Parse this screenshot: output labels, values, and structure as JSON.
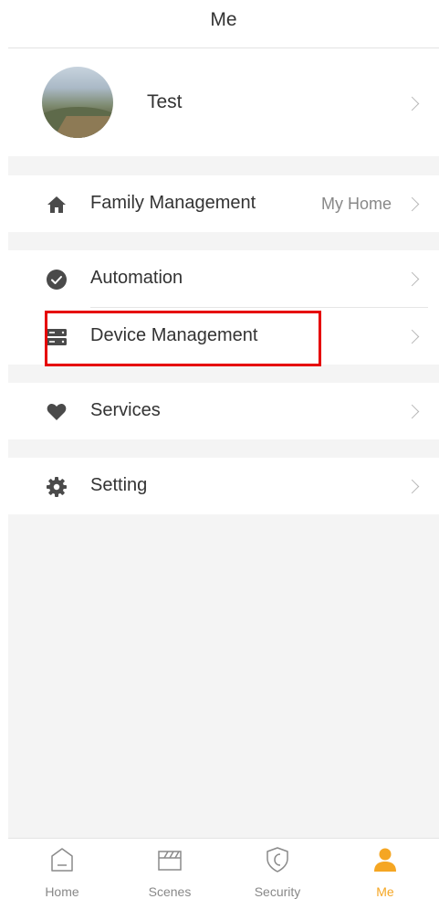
{
  "header": {
    "title": "Me"
  },
  "profile": {
    "name": "Test"
  },
  "menu": {
    "family": {
      "label": "Family Management",
      "value": "My Home"
    },
    "automation": {
      "label": "Automation"
    },
    "device": {
      "label": "Device Management"
    },
    "services": {
      "label": "Services"
    },
    "setting": {
      "label": "Setting"
    }
  },
  "icons": {
    "family": "home-icon",
    "automation": "check-circle-icon",
    "device": "server-icon",
    "services": "heart-icon",
    "setting": "gear-icon"
  },
  "tabs": [
    {
      "label": "Home",
      "icon": "home-outline-icon",
      "active": false
    },
    {
      "label": "Scenes",
      "icon": "clapperboard-icon",
      "active": false
    },
    {
      "label": "Security",
      "icon": "shield-icon",
      "active": false
    },
    {
      "label": "Me",
      "icon": "person-icon",
      "active": true
    }
  ],
  "colors": {
    "accent": "#f5a623",
    "highlight": "#e60000",
    "icon": "#4a4a4a",
    "muted": "#888888"
  }
}
